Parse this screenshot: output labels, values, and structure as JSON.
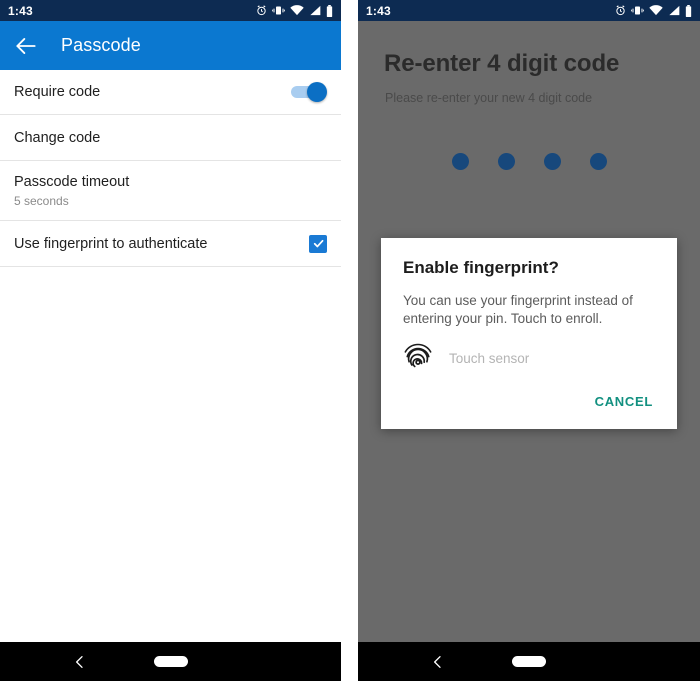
{
  "left_phone": {
    "status_bar": {
      "time": "1:43",
      "icons": [
        "alarm-icon",
        "vibrate-icon",
        "wifi-icon",
        "signal-icon",
        "battery-icon"
      ]
    },
    "app_bar": {
      "back_icon": "back-arrow-icon",
      "title": "Passcode",
      "background_color": "#0b78d0"
    },
    "settings": [
      {
        "title": "Require code",
        "subtitle": "",
        "control": "toggle",
        "value": "on"
      },
      {
        "title": "Change code",
        "subtitle": "",
        "control": "none",
        "value": ""
      },
      {
        "title": "Passcode timeout",
        "subtitle": "5 seconds",
        "control": "none",
        "value": ""
      },
      {
        "title": "Use fingerprint to authenticate",
        "subtitle": "",
        "control": "checkbox",
        "value": "checked"
      }
    ],
    "nav_bar": {
      "back_icon": "nav-back-icon",
      "home_indicator": "home-pill"
    }
  },
  "right_phone": {
    "status_bar": {
      "time": "1:43",
      "icons": [
        "alarm-icon",
        "vibrate-icon",
        "wifi-icon",
        "signal-icon",
        "battery-icon"
      ]
    },
    "pin_screen": {
      "heading": "Re-enter 4 digit code",
      "subheading": "Please re-enter your new 4 digit code",
      "dots_filled": 4,
      "dot_color": "#17487c",
      "scrim_color": "#6a6a6a"
    },
    "dialog": {
      "title": "Enable fingerprint?",
      "body": "You can use your fingerprint instead of entering your pin. Touch to enroll.",
      "sensor_icon": "fingerprint-icon",
      "sensor_label": "Touch sensor",
      "cancel_label": "CANCEL",
      "cancel_color": "#129080"
    },
    "nav_bar": {
      "back_icon": "nav-back-icon",
      "home_indicator": "home-pill"
    }
  }
}
